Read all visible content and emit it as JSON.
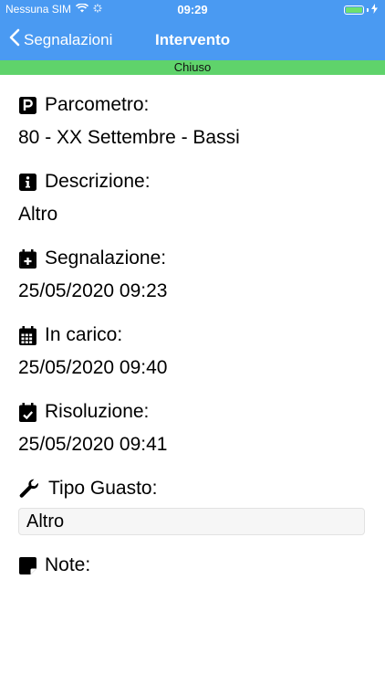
{
  "status": {
    "carrier": "Nessuna SIM",
    "time": "09:29"
  },
  "nav": {
    "back_label": "Segnalazioni",
    "title": "Intervento"
  },
  "state_banner": "Chiuso",
  "fields": {
    "parcometro": {
      "label": "Parcometro:",
      "value": "80 - XX Settembre - Bassi",
      "icon": "parking-icon"
    },
    "descrizione": {
      "label": "Descrizione:",
      "value": "Altro",
      "icon": "info-icon"
    },
    "segnalazione": {
      "label": "Segnalazione:",
      "value": "25/05/2020 09:23",
      "icon": "calendar-plus-icon"
    },
    "in_carico": {
      "label": "In carico:",
      "value": "25/05/2020 09:40",
      "icon": "calendar-icon"
    },
    "risoluzione": {
      "label": "Risoluzione:",
      "value": "25/05/2020 09:41",
      "icon": "calendar-check-icon"
    },
    "tipo_guasto": {
      "label": "Tipo Guasto:",
      "value": "Altro",
      "icon": "wrench-icon"
    },
    "note": {
      "label": "Note:",
      "icon": "note-icon"
    }
  },
  "colors": {
    "nav": "#4a9af2",
    "banner": "#5fd36b"
  }
}
